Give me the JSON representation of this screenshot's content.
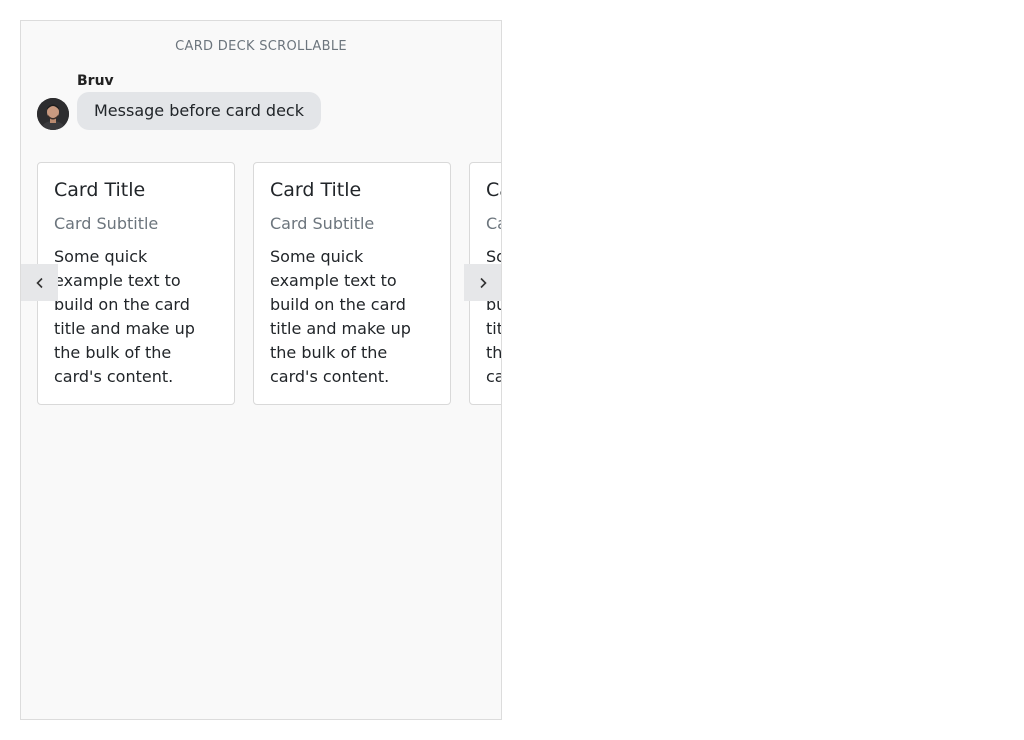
{
  "window": {
    "title": "CARD DECK SCROLLABLE"
  },
  "message": {
    "sender": "Bruv",
    "text": "Message before card deck",
    "avatar_icon": "user-avatar"
  },
  "deck": {
    "prev_icon": "chevron-left-icon",
    "next_icon": "chevron-right-icon",
    "cards": [
      {
        "title": "Card Title",
        "subtitle": "Card Subtitle",
        "text": "Some quick example text to build on the card title and make up the bulk of the card's content."
      },
      {
        "title": "Card Title",
        "subtitle": "Card Subtitle",
        "text": "Some quick example text to build on the card title and make up the bulk of the card's content."
      },
      {
        "title": "Card Title",
        "subtitle": "Card Subtitle",
        "text": "Some quick example text to build on the card title and make up the bulk of the card's content."
      }
    ]
  },
  "colors": {
    "window_bg": "#f9f9f9",
    "bubble_bg": "#e3e5e8",
    "nav_button_bg": "#e6e7e9",
    "muted_text": "#6c757d"
  }
}
